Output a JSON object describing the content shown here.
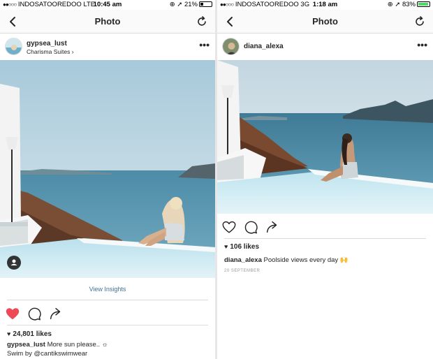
{
  "left": {
    "status": {
      "carrier": "INDOSATOOREDOO",
      "network": "LTE",
      "time": "10:45 am",
      "battery": "21%",
      "battery_level": 0.21
    },
    "nav": {
      "title": "Photo"
    },
    "post": {
      "username": "gypsea_lust",
      "location": "Charisma Suites",
      "more": "•••",
      "view_insights": "View Insights",
      "likes": "24,801 likes",
      "caption_user": "gypsea_lust",
      "caption_text": "More sun please.. ☼",
      "caption_line2": "Swim by @cantikswimwear",
      "liked": true
    }
  },
  "right": {
    "status": {
      "carrier": "INDOSATOOREDOO",
      "network": "3G",
      "time": "1:18 am",
      "battery": "83%",
      "battery_level": 0.83
    },
    "nav": {
      "title": "Photo"
    },
    "post": {
      "username": "diana_alexa",
      "more": "•••",
      "likes": "106 likes",
      "caption_user": "diana_alexa",
      "caption_text": "Poolside views every day 🙌",
      "date": "20 SEPTEMBER",
      "liked": false
    }
  },
  "colors": {
    "like_red": "#ed4956",
    "link_blue": "#3f729b",
    "battery_green": "#4cd964"
  },
  "icons": [
    "back-chevron-icon",
    "refresh-icon",
    "more-dots-icon",
    "heart-icon",
    "comment-icon",
    "share-icon",
    "user-tag-icon",
    "location-chevron-icon"
  ]
}
